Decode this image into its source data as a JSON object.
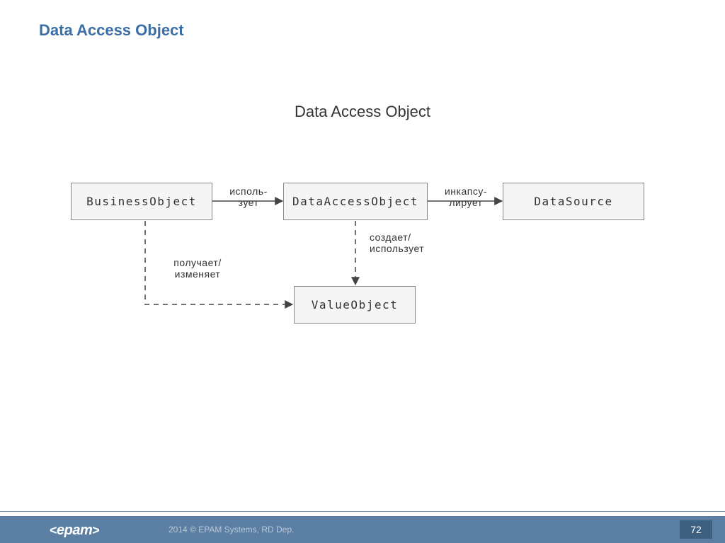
{
  "slide": {
    "title": "Data Access Object",
    "diagram_title": "Data Access Object"
  },
  "nodes": {
    "business_object": "BusinessObject",
    "data_access_object": "DataAccessObject",
    "data_source": "DataSource",
    "value_object": "ValueObject"
  },
  "edges": {
    "bo_to_dao": "исполь-\nзует",
    "dao_to_ds": "инкапсу-\nлирует",
    "dao_to_vo": "создает/\nиспользует",
    "bo_to_vo": "получает/\nизменяет"
  },
  "footer": {
    "logo": "<epam>",
    "copyright": "2014 © EPAM Systems, RD Dep.",
    "page": "72"
  }
}
